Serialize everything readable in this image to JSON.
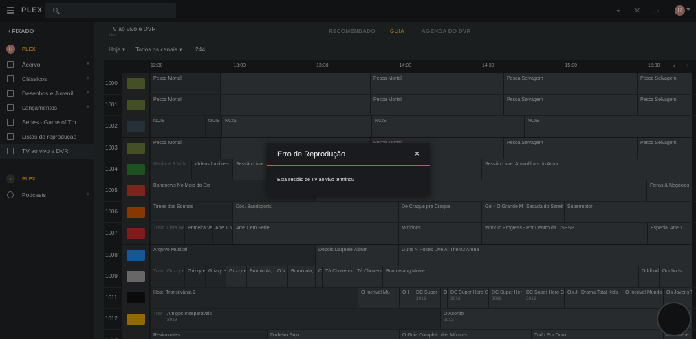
{
  "app": {
    "logo_main": "PLEX",
    "logo_accent": ""
  },
  "topbar": {
    "user_initial": "R"
  },
  "sidebar": {
    "back_label": "FIXADO",
    "server1": {
      "initial": "R",
      "label": "PLEX"
    },
    "items": [
      {
        "label": "Acervo"
      },
      {
        "label": "Clássicos"
      },
      {
        "label": "Desenhos e Juvenil"
      },
      {
        "label": "Lançamentos"
      },
      {
        "label": "Séries - Game of Thr..."
      },
      {
        "label": "Listas de reprodução"
      },
      {
        "label": "TV ao vivo e DVR"
      }
    ],
    "server2": {
      "label": "PLEX"
    },
    "podcasts_label": "Podcasts"
  },
  "page": {
    "title": "TV ao vivo e DVR",
    "subtitle": "plex"
  },
  "tabs": [
    {
      "label": "RECOMENDADO"
    },
    {
      "label": "GUIA"
    },
    {
      "label": "AGENDA DO DVR"
    }
  ],
  "filters": {
    "day": "Hoje",
    "channels": "Todos os canais",
    "count": "244"
  },
  "times": [
    "12:30",
    "13:00",
    "13:30",
    "14:00",
    "14:30",
    "15:00",
    "15:30"
  ],
  "channels": [
    {
      "num": "1000",
      "logo": "AP",
      "programs": [
        {
          "t": "Pesca Mortal",
          "s": 0,
          "w": 102
        },
        {
          "t": "",
          "s": 102,
          "w": 218
        },
        {
          "t": "Pesca Mortal",
          "s": 320,
          "w": 194
        },
        {
          "t": "Pesca Selvagem",
          "s": 514,
          "w": 194
        },
        {
          "t": "Pesca Selvagem",
          "s": 708,
          "w": 80
        }
      ]
    },
    {
      "num": "1001",
      "logo": "AP",
      "programs": [
        {
          "t": "Pesca Mortal",
          "s": 0,
          "w": 102
        },
        {
          "t": "",
          "s": 102,
          "w": 218
        },
        {
          "t": "Pesca Mortal",
          "s": 320,
          "w": 194
        },
        {
          "t": "Pesca Selvagem",
          "s": 514,
          "w": 194
        },
        {
          "t": "Pesca Selvagem",
          "s": 708,
          "w": 80
        }
      ]
    },
    {
      "num": "1002",
      "logo": "AXN",
      "programs": [
        {
          "t": "NCIS",
          "s": 0,
          "w": 80
        },
        {
          "t": "NCIS",
          "s": 80,
          "w": 24
        },
        {
          "t": "NCIS",
          "s": 104,
          "w": 218
        },
        {
          "t": "NCIS",
          "s": 322,
          "w": 222
        },
        {
          "t": "NCIS",
          "s": 544,
          "w": 244
        }
      ]
    },
    {
      "num": "1003",
      "logo": "AP",
      "programs": [
        {
          "t": "Pesca Mortal",
          "s": 0,
          "w": 102
        },
        {
          "t": "",
          "s": 102,
          "w": 218
        },
        {
          "t": "Pesca Mortal",
          "s": 320,
          "w": 194
        },
        {
          "t": "Pesca Selvagem",
          "s": 514,
          "w": 194
        },
        {
          "t": "Pesca Selvagem",
          "s": 708,
          "w": 80
        }
      ]
    },
    {
      "num": "1004",
      "logo": "BD",
      "programs": [
        {
          "t": "Verdade & Vida",
          "s": 0,
          "w": 60,
          "dim": true
        },
        {
          "t": "Vídeos Incríveis",
          "s": 60,
          "w": 60
        },
        {
          "t": "Sessão Livre: Armadilhas do Amor",
          "s": 120,
          "w": 362
        },
        {
          "t": "Sessão Livre: Armadilhas do Amor",
          "s": 482,
          "w": 306
        }
      ]
    },
    {
      "num": "1005",
      "logo": "BN",
      "programs": [
        {
          "t": "Bandnews No Meio do Dia",
          "s": 0,
          "w": 240
        },
        {
          "t": "Bandnews",
          "s": 240,
          "w": 482
        },
        {
          "t": "Feiras & Negócios",
          "s": 722,
          "w": 66
        }
      ]
    },
    {
      "num": "1006",
      "logo": "BS",
      "programs": [
        {
          "t": "Times dos Sonhos",
          "s": 0,
          "w": 120
        },
        {
          "t": "Doc. Bandsports",
          "s": 120,
          "w": 241
        },
        {
          "t": "De Craque pra Craque",
          "s": 361,
          "w": 121
        },
        {
          "t": "Gol - O Grande Mo",
          "s": 482,
          "w": 60
        },
        {
          "t": "Sacada do Sarett",
          "s": 542,
          "w": 60
        },
        {
          "t": "Supermotor",
          "s": 602,
          "w": 186
        }
      ]
    },
    {
      "num": "1007",
      "logo": "A1",
      "programs": [
        {
          "t": "Tram",
          "s": 0,
          "w": 20,
          "dim": true
        },
        {
          "t": "Lista Ne",
          "s": 20,
          "w": 30,
          "dim": true
        },
        {
          "t": "Primeira Ve",
          "s": 50,
          "w": 40
        },
        {
          "t": "Arte 1 N",
          "s": 90,
          "w": 30
        },
        {
          "t": "Arte 1 em Série",
          "s": 120,
          "w": 241
        },
        {
          "t": "Minidocs",
          "s": 361,
          "w": 121
        },
        {
          "t": "Work In Progress - Por Dentro da OSESP",
          "s": 482,
          "w": 241
        },
        {
          "t": "Especial Arte 1",
          "s": 723,
          "w": 65
        }
      ]
    },
    {
      "num": "1008",
      "logo": "BIS",
      "programs": [
        {
          "t": "Arquivo Musical",
          "s": 0,
          "w": 240
        },
        {
          "t": "Depois Daquele Álbum",
          "s": 240,
          "w": 121
        },
        {
          "t": "Guns N Roses Live At The 02 Arena",
          "s": 361,
          "w": 427
        }
      ]
    },
    {
      "num": "1009",
      "logo": "BM",
      "programs": [
        {
          "t": "Tram",
          "s": 0,
          "w": 20,
          "dim": true
        },
        {
          "t": "Grizzy e",
          "s": 20,
          "w": 30,
          "dim": true
        },
        {
          "t": "Grizzy e",
          "s": 50,
          "w": 30
        },
        {
          "t": "Grizzy e",
          "s": 80,
          "w": 30
        },
        {
          "t": "Grizzy e",
          "s": 110,
          "w": 30
        },
        {
          "t": "Bunnicula,",
          "s": 140,
          "w": 40
        },
        {
          "t": "O V.",
          "s": 180,
          "w": 20
        },
        {
          "t": "Bunnicula,",
          "s": 200,
          "w": 40
        },
        {
          "t": "C",
          "s": 240,
          "w": 10
        },
        {
          "t": "Tá Chovendo Ha",
          "s": 250,
          "w": 46
        },
        {
          "t": "Tá Chovendo",
          "s": 296,
          "w": 42
        },
        {
          "t": "Boomerang Movie",
          "s": 338,
          "w": 372
        },
        {
          "t": "Oddbods",
          "s": 710,
          "w": 30
        },
        {
          "t": "Oddbods",
          "s": 740,
          "w": 48
        }
      ]
    },
    {
      "num": "1011",
      "logo": "CN",
      "programs": [
        {
          "t": "Hotel Transilvânia 2",
          "s": 0,
          "w": 302
        },
        {
          "t": "O Incrível Mu",
          "s": 302,
          "w": 60
        },
        {
          "t": "O I",
          "s": 362,
          "w": 20
        },
        {
          "t": "DC Super",
          "s": 382,
          "w": 40,
          "y": "2016"
        },
        {
          "t": "O",
          "s": 422,
          "w": 10
        },
        {
          "t": "DC Super Hero Girl",
          "s": 432,
          "w": 60,
          "y": "2016"
        },
        {
          "t": "DC Super Her",
          "s": 492,
          "w": 50,
          "y": "2016"
        },
        {
          "t": "DC Super Hero Girl",
          "s": 542,
          "w": 60,
          "y": "2016"
        },
        {
          "t": "Os Jo",
          "s": 602,
          "w": 20
        },
        {
          "t": "Drama Total Kids",
          "s": 622,
          "w": 64
        },
        {
          "t": "O Incrível Mundo",
          "s": 686,
          "w": 60
        },
        {
          "t": "Os Jovens Tit",
          "s": 746,
          "w": 42
        }
      ]
    },
    {
      "num": "1012",
      "logo": "CI",
      "programs": [
        {
          "t": "Trar",
          "s": 0,
          "w": 20,
          "dim": true
        },
        {
          "t": "Amigos Inseparáveis",
          "s": 20,
          "w": 402,
          "y": "2013"
        },
        {
          "t": "O Acordo",
          "s": 422,
          "w": 366,
          "y": "2013"
        }
      ]
    },
    {
      "num": "1013",
      "logo": "",
      "programs": [
        {
          "t": "Reviravoltas",
          "s": 0,
          "w": 170
        },
        {
          "t": "Dinheiro Sujo",
          "s": 170,
          "w": 192
        },
        {
          "t": "O Guia Completo das Múmias",
          "s": 362,
          "w": 192
        },
        {
          "t": "Tudo Por Ouro",
          "s": 554,
          "w": 192
        },
        {
          "t": "Os Anti-he",
          "s": 746,
          "w": 42
        }
      ]
    }
  ],
  "modal": {
    "title": "Erro de Reprodução",
    "close": "×",
    "message": "Esta sessão de TV ao vivo terminou"
  }
}
